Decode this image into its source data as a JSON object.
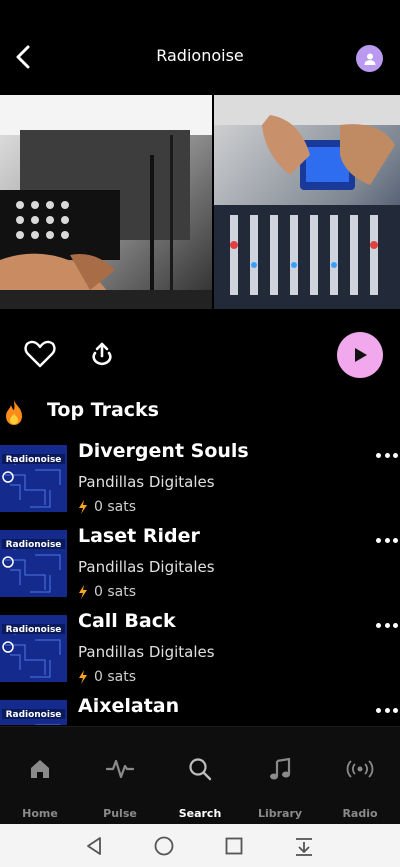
{
  "header": {
    "title": "Radionoise"
  },
  "colors": {
    "accent": "#f2a8ec",
    "avatar": "#b99af0",
    "fire": "#ff8c1a",
    "bolt": "#f5a623"
  },
  "section": {
    "title": "Top Tracks"
  },
  "tracks": [
    {
      "title": "Divergent Souls",
      "artist": "Pandillas Digitales",
      "sats": "0 sats"
    },
    {
      "title": "Laset Rider",
      "artist": "Pandillas Digitales",
      "sats": "0 sats"
    },
    {
      "title": "Call Back",
      "artist": "Pandillas Digitales",
      "sats": "0 sats"
    },
    {
      "title": "Aixelatan",
      "artist": "",
      "sats": ""
    }
  ],
  "cover_text": "Radionoise",
  "nav": {
    "items": [
      {
        "label": "Home",
        "icon": "home-icon"
      },
      {
        "label": "Pulse",
        "icon": "pulse-icon"
      },
      {
        "label": "Search",
        "icon": "search-icon"
      },
      {
        "label": "Library",
        "icon": "music-note-icon"
      },
      {
        "label": "Radio",
        "icon": "radio-icon"
      }
    ],
    "active": "Search"
  }
}
